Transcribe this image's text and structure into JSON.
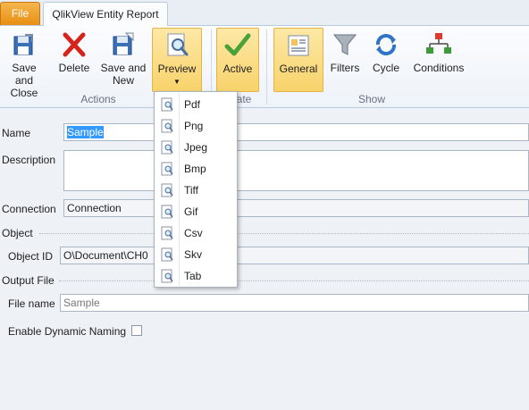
{
  "tabs": {
    "file": "File",
    "active_tab": "QlikView Entity Report"
  },
  "ribbon": {
    "buttons": {
      "save_close": "Save and\nClose",
      "delete": "Delete",
      "save_new": "Save and\nNew",
      "preview": "Preview",
      "active": "Active",
      "general": "General",
      "filters": "Filters",
      "cycle": "Cycle",
      "conditions": "Conditions"
    },
    "groups": {
      "actions": "Actions",
      "update": "ate",
      "show": "Show"
    }
  },
  "form": {
    "name_label": "Name",
    "name_value": "Sample",
    "description_label": "Description",
    "description_value": "",
    "connection_label": "Connection",
    "connection_value": "Connection",
    "object_section": "Object",
    "object_id_label": "Object ID",
    "object_id_value": "O\\Document\\CH0",
    "output_section": "Output File",
    "file_name_label": "File name",
    "file_name_placeholder": "Sample",
    "dynamic_naming_label": "Enable Dynamic Naming",
    "dynamic_naming_checked": false
  },
  "preview_menu": {
    "items": [
      "Pdf",
      "Png",
      "Jpeg",
      "Bmp",
      "Tiff",
      "Gif",
      "Csv",
      "Skv",
      "Tab"
    ]
  },
  "colors": {
    "file_tab": "#e88f14",
    "highlight": "#f8d36b",
    "selection": "#3399ff"
  }
}
